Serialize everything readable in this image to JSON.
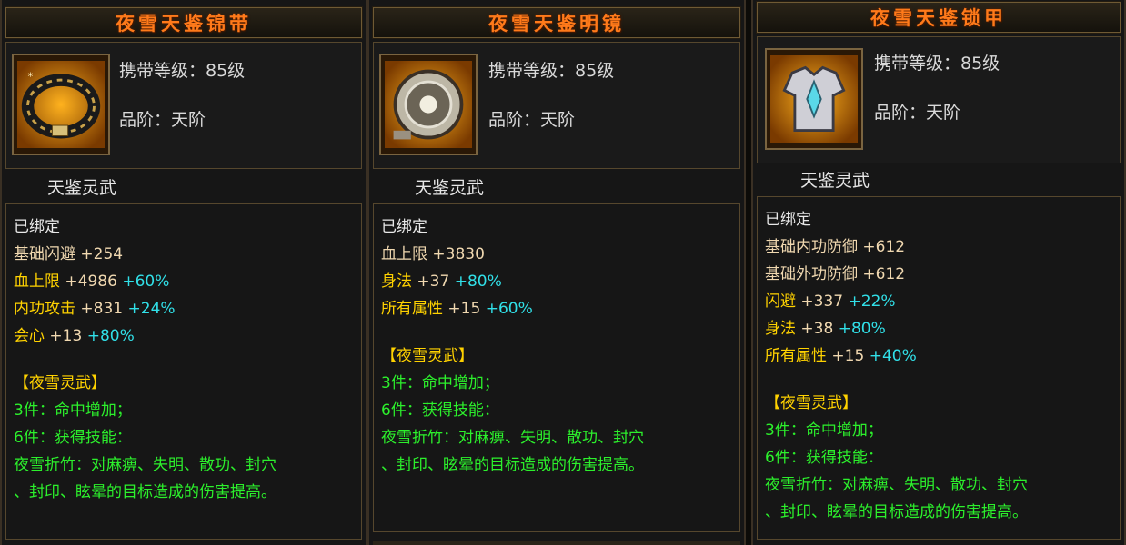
{
  "panels": [
    {
      "title": "夜雪天鉴锦带",
      "level_line": "携带等级：85级",
      "grade_line": "品阶：天阶",
      "set_label": "天鉴灵武",
      "icon": "belt-icon",
      "bound": "已绑定",
      "stats": [
        {
          "name": "基础闪避",
          "value": "+254",
          "bonus": ""
        },
        {
          "name": "血上限",
          "value": "+4986",
          "bonus": "+60%"
        },
        {
          "name": "内功攻击",
          "value": "+831",
          "bonus": "+24%"
        },
        {
          "name": "会心",
          "value": "+13",
          "bonus": "+80%"
        }
      ],
      "set_title": "【夜雪灵武】",
      "set_lines": [
        "3件：命中增加；",
        "6件：获得技能：",
        "夜雪折竹：对麻痹、失明、散功、封穴",
        "、封印、眩晕的目标造成的伤害提高。"
      ]
    },
    {
      "title": "夜雪天鉴明镜",
      "level_line": "携带等级：85级",
      "grade_line": "品阶：天阶",
      "set_label": "天鉴灵武",
      "icon": "mirror-icon",
      "bound": "已绑定",
      "stats": [
        {
          "name": "血上限",
          "value": "+3830",
          "bonus": ""
        },
        {
          "name": "身法",
          "value": "+37",
          "bonus": "+80%"
        },
        {
          "name": "所有属性",
          "value": "+15",
          "bonus": "+60%"
        }
      ],
      "set_title": "【夜雪灵武】",
      "set_lines": [
        "3件：命中增加；",
        "6件：获得技能：",
        "夜雪折竹：对麻痹、失明、散功、封穴",
        "、封印、眩晕的目标造成的伤害提高。"
      ]
    },
    {
      "title": "夜雪天鉴锁甲",
      "level_line": "携带等级：85级",
      "grade_line": "品阶：天阶",
      "set_label": "天鉴灵武",
      "icon": "armor-icon",
      "bound": "已绑定",
      "stats": [
        {
          "name": "基础内功防御",
          "value": "+612",
          "bonus": ""
        },
        {
          "name": "基础外功防御",
          "value": "+612",
          "bonus": ""
        },
        {
          "name": "闪避",
          "value": "+337",
          "bonus": "+22%"
        },
        {
          "name": "身法",
          "value": "+38",
          "bonus": "+80%"
        },
        {
          "name": "所有属性",
          "value": "+15",
          "bonus": "+40%"
        }
      ],
      "set_title": "【夜雪灵武】",
      "set_lines": [
        "3件：命中增加；",
        "6件：获得技能：",
        "夜雪折竹：对麻痹、失明、散功、封穴",
        "、封印、眩晕的目标造成的伤害提高。"
      ]
    }
  ]
}
